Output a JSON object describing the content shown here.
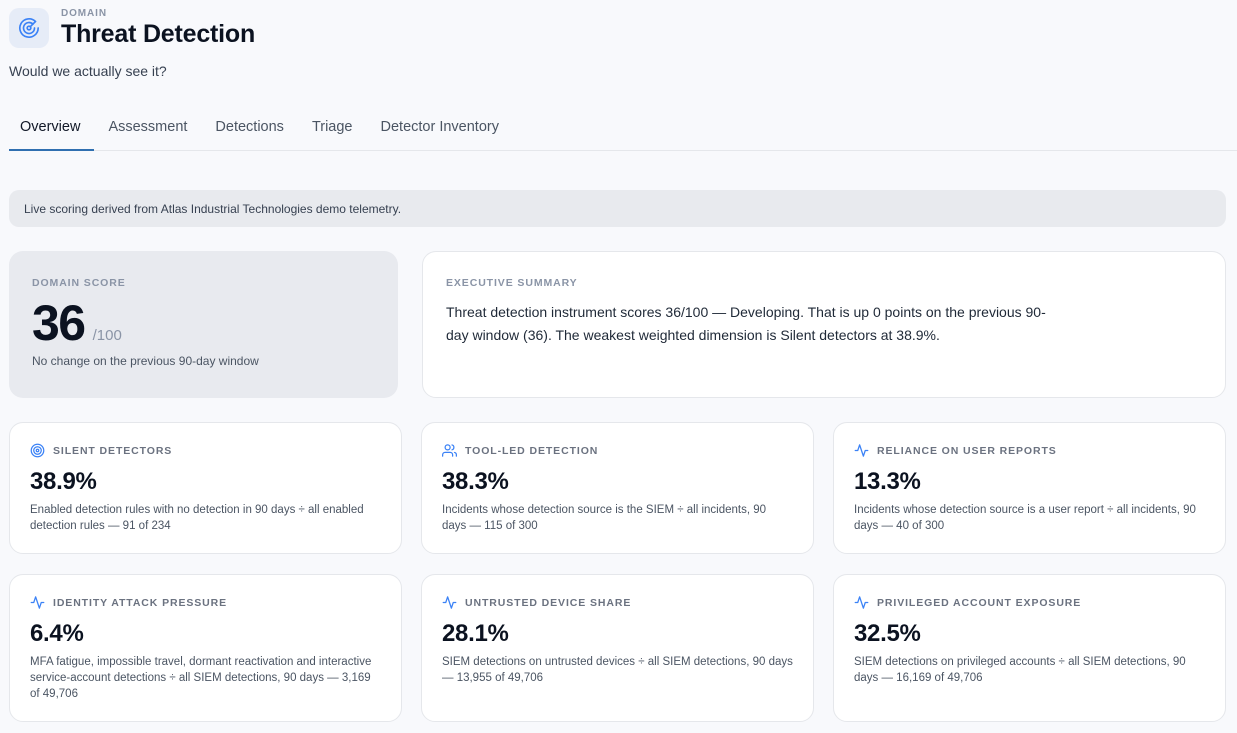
{
  "header": {
    "eyebrow": "DOMAIN",
    "title": "Threat Detection",
    "subtitle": "Would we actually see it?",
    "icon": "radar-target-icon"
  },
  "tabs": [
    {
      "label": "Overview",
      "active": true
    },
    {
      "label": "Assessment",
      "active": false
    },
    {
      "label": "Detections",
      "active": false
    },
    {
      "label": "Triage",
      "active": false
    },
    {
      "label": "Detector Inventory",
      "active": false
    }
  ],
  "banner": "Live scoring derived from Atlas Industrial Technologies demo telemetry.",
  "score": {
    "eyebrow": "DOMAIN SCORE",
    "value": "36",
    "denominator": "/100",
    "note": "No change on the previous 90-day window"
  },
  "summary": {
    "eyebrow": "EXECUTIVE SUMMARY",
    "text": "Threat detection instrument scores 36/100 — Developing. That is up 0 points on the previous 90-day window (36). The weakest weighted dimension is Silent detectors at 38.9%."
  },
  "metrics": [
    {
      "icon": "target-icon",
      "label": "SILENT DETECTORS",
      "value": "38.9%",
      "desc": "Enabled detection rules with no detection in 90 days ÷ all enabled detection rules — 91 of 234"
    },
    {
      "icon": "users-icon",
      "label": "TOOL-LED DETECTION",
      "value": "38.3%",
      "desc": "Incidents whose detection source is the SIEM ÷ all incidents, 90 days — 115 of 300"
    },
    {
      "icon": "activity-icon",
      "label": "RELIANCE ON USER REPORTS",
      "value": "13.3%",
      "desc": "Incidents whose detection source is a user report ÷ all incidents, 90 days — 40 of 300"
    },
    {
      "icon": "activity-icon",
      "label": "IDENTITY ATTACK PRESSURE",
      "value": "6.4%",
      "desc": "MFA fatigue, impossible travel, dormant reactivation and interactive service-account detections ÷ all SIEM detections, 90 days — 3,169 of 49,706"
    },
    {
      "icon": "activity-icon",
      "label": "UNTRUSTED DEVICE SHARE",
      "value": "28.1%",
      "desc": "SIEM detections on untrusted devices ÷ all SIEM detections, 90 days — 13,955 of 49,706"
    },
    {
      "icon": "activity-icon",
      "label": "PRIVILEGED ACCOUNT EXPOSURE",
      "value": "32.5%",
      "desc": "SIEM detections on privileged accounts ÷ all SIEM detections, 90 days — 16,169 of 49,706"
    }
  ],
  "colors": {
    "accent": "#2f6fb0",
    "icon_blue": "#3b82f6",
    "score_card_bg": "#e8eaef",
    "banner_bg": "#e8eaee"
  }
}
